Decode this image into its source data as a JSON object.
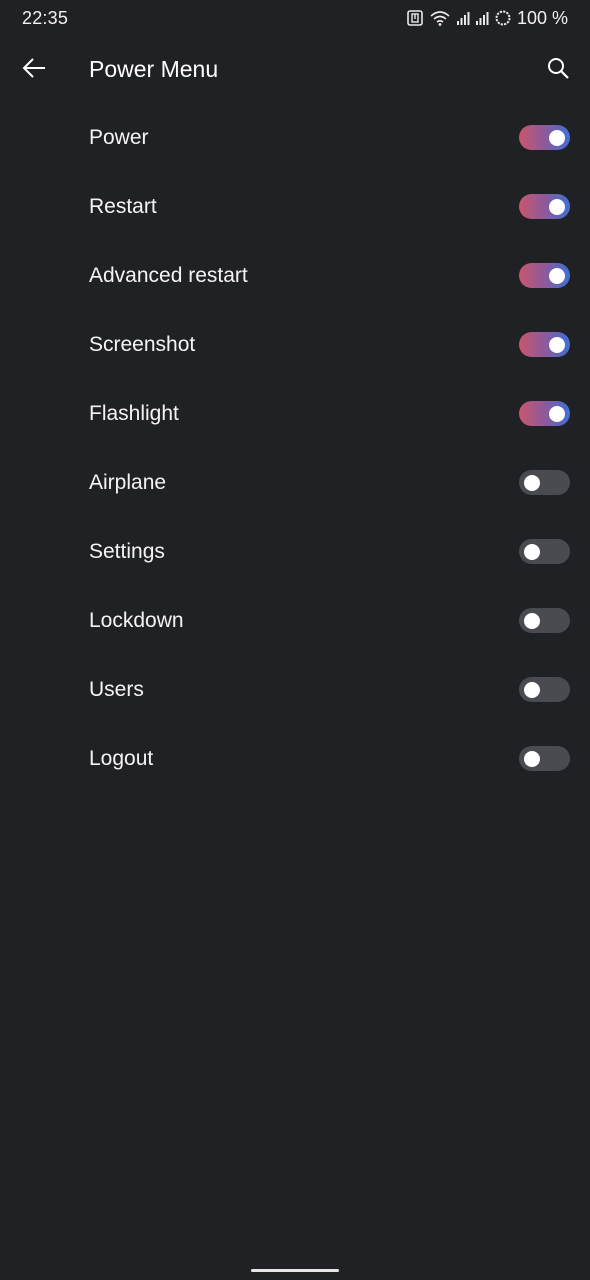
{
  "status_bar": {
    "time": "22:35",
    "battery": "100 %",
    "icons": [
      "nfc-icon",
      "wifi-icon",
      "signal-icon",
      "signal-icon",
      "battery-saver-icon"
    ]
  },
  "app_bar": {
    "title": "Power Menu",
    "back_icon": "arrow-left-icon",
    "search_icon": "search-icon"
  },
  "items": [
    {
      "label": "Power",
      "enabled": true
    },
    {
      "label": "Restart",
      "enabled": true
    },
    {
      "label": "Advanced restart",
      "enabled": true
    },
    {
      "label": "Screenshot",
      "enabled": true
    },
    {
      "label": "Flashlight",
      "enabled": true
    },
    {
      "label": "Airplane",
      "enabled": false
    },
    {
      "label": "Settings",
      "enabled": false
    },
    {
      "label": "Lockdown",
      "enabled": false
    },
    {
      "label": "Users",
      "enabled": false
    },
    {
      "label": "Logout",
      "enabled": false
    }
  ],
  "colors": {
    "background": "#202125",
    "toggle_on_start": "#c9566f",
    "toggle_on_end": "#3e6fd6",
    "toggle_off": "#4a4b50"
  }
}
